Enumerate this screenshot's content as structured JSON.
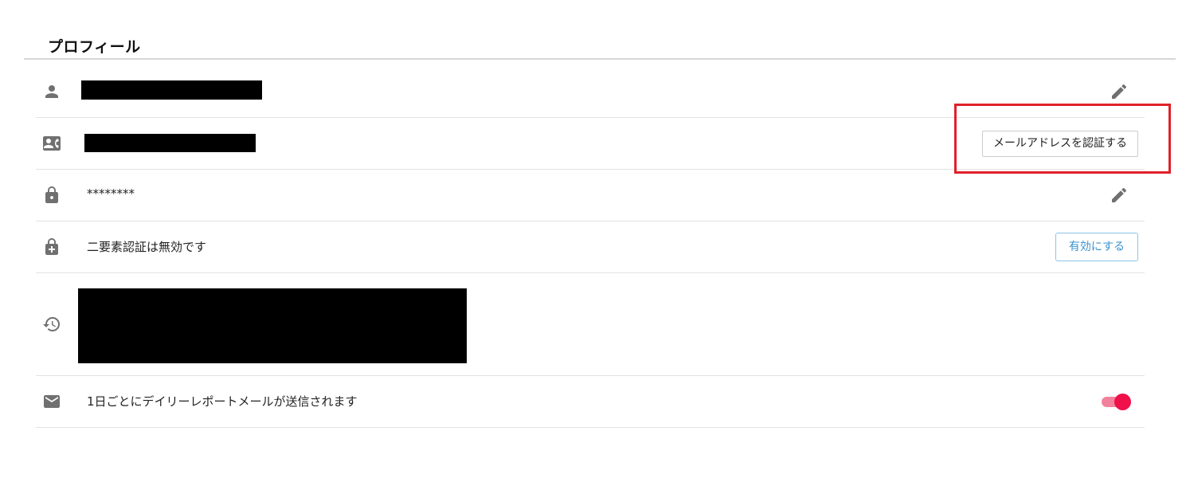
{
  "profile": {
    "title": "プロフィール",
    "name_row": {
      "icon": "person-icon",
      "value": "",
      "action_icon": "pencil-icon"
    },
    "email_row": {
      "icon": "contact-mail-icon",
      "value": "",
      "verify_label": "メールアドレスを認証する"
    },
    "password_row": {
      "icon": "lock-icon",
      "value": "********",
      "action_icon": "pencil-icon"
    },
    "two_factor_row": {
      "icon": "lock-plus-icon",
      "status": "二要素認証は無効です",
      "enable_label": "有効にする"
    },
    "history_row": {
      "icon": "history-icon",
      "value": ""
    },
    "report_row": {
      "icon": "mail-icon",
      "text": "1日ごとにデイリーレポートメールが送信されます",
      "toggle_on": true
    }
  },
  "colors": {
    "accent_toggle": "#f0104a",
    "highlight_border": "#e0202a",
    "link_blue": "#3b93cf",
    "icon_grey": "#707070"
  }
}
